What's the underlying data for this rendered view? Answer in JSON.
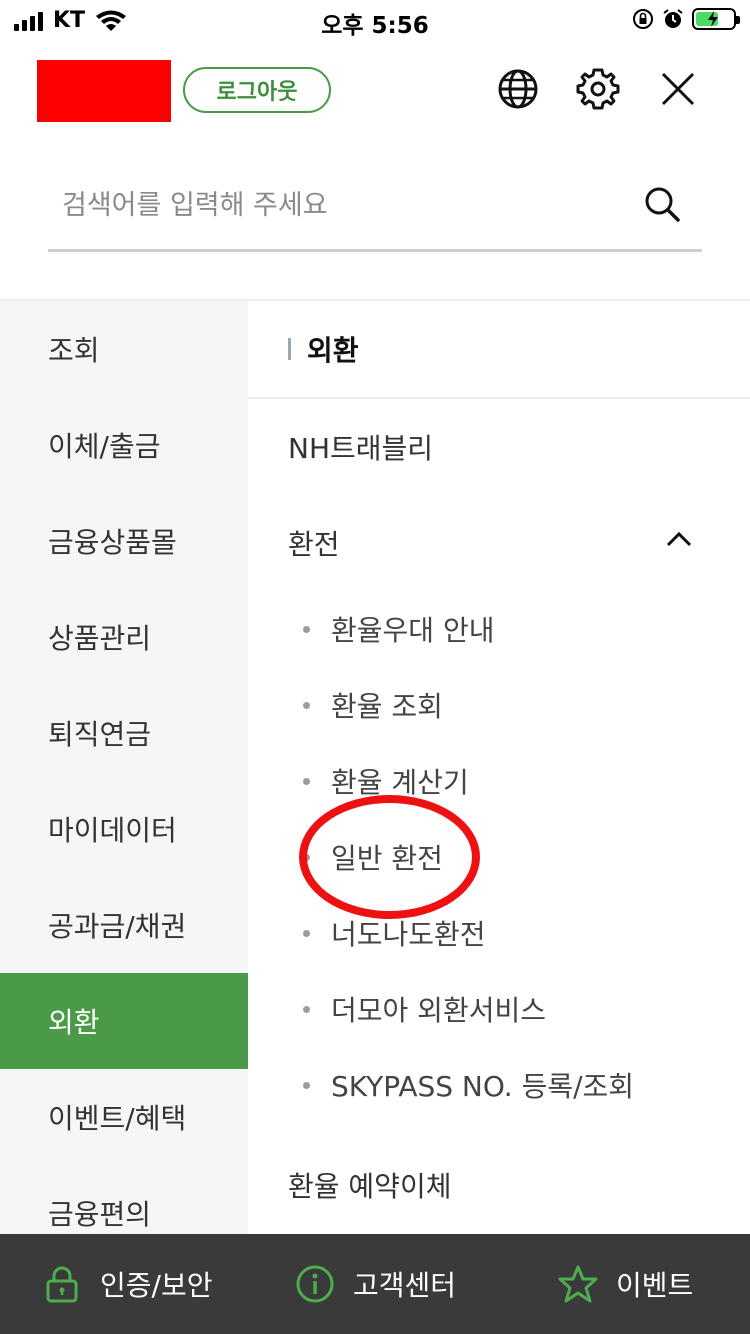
{
  "status_bar": {
    "carrier": "KT",
    "time": "오후 5:56"
  },
  "header": {
    "logout_label": "로그아웃",
    "icons": [
      "globe-icon",
      "gear-icon",
      "close-icon"
    ]
  },
  "search": {
    "placeholder": "검색어를 입력해 주세요"
  },
  "sidebar": {
    "items": [
      {
        "label": "조회"
      },
      {
        "label": "이체/출금"
      },
      {
        "label": "금융상품몰"
      },
      {
        "label": "상품관리"
      },
      {
        "label": "퇴직연금"
      },
      {
        "label": "마이데이터"
      },
      {
        "label": "공과금/채권"
      },
      {
        "label": "외환"
      },
      {
        "label": "이벤트/혜택"
      },
      {
        "label": "금융편의"
      }
    ],
    "active_index": 7
  },
  "panel": {
    "section_title": "외환",
    "menu": {
      "first": "NH트래블리",
      "expanded": "환전",
      "sub_items": [
        {
          "label": "환율우대 안내"
        },
        {
          "label": "환율 조회"
        },
        {
          "label": "환율 계산기"
        },
        {
          "label": "일반 환전"
        },
        {
          "label": "너도나도환전"
        },
        {
          "label": "더모아 외환서비스"
        },
        {
          "label": "SKYPASS NO. 등록/조회"
        }
      ],
      "last": "환율 예약이체"
    }
  },
  "bottom_bar": {
    "items": [
      {
        "label": "인증/보안",
        "icon": "lock-icon"
      },
      {
        "label": "고객센터",
        "icon": "info-icon"
      },
      {
        "label": "이벤트",
        "icon": "star-icon"
      }
    ]
  },
  "colors": {
    "accent_green": "#4a9a47",
    "annotation_red": "#ee1111",
    "bottom_bar": "#3a3a3a"
  }
}
